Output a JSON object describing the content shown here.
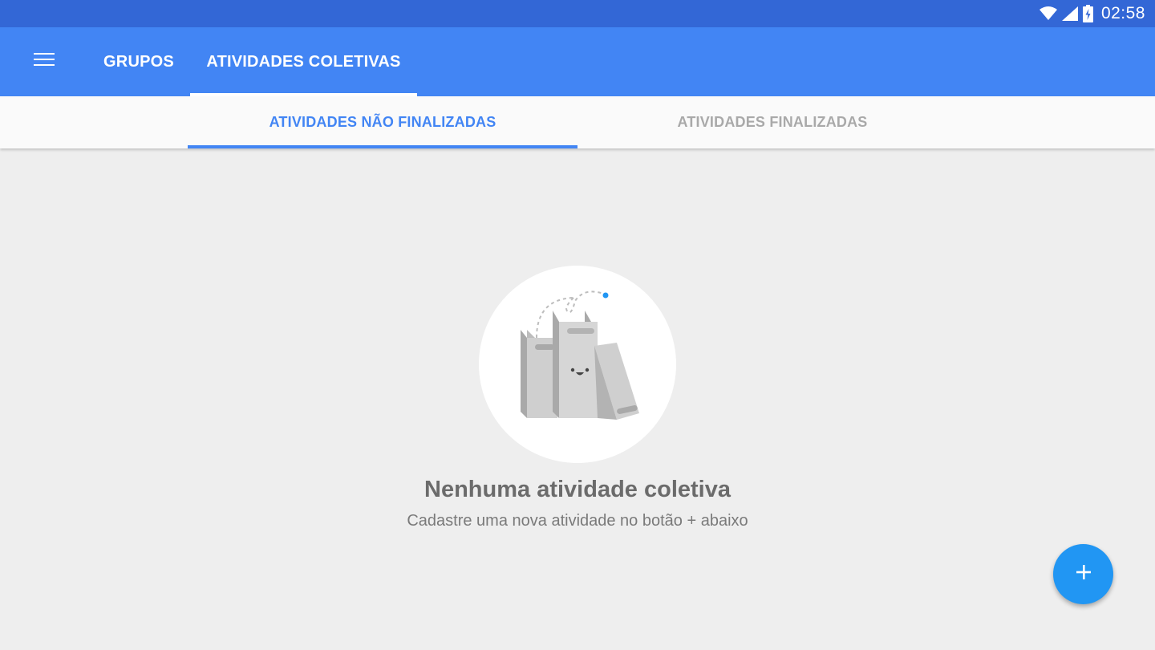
{
  "status_bar": {
    "time": "02:58",
    "icons": [
      "wifi-icon",
      "cell-signal-icon",
      "battery-charging-icon"
    ]
  },
  "app_bar": {
    "menu_icon": "hamburger-menu-icon",
    "tabs": [
      {
        "label": "GRUPOS",
        "selected": false
      },
      {
        "label": "ATIVIDADES COLETIVAS",
        "selected": true
      }
    ]
  },
  "sub_tabs": [
    {
      "label": "ATIVIDADES NÃO FINALIZADAS",
      "selected": true
    },
    {
      "label": "ATIVIDADES FINALIZADAS",
      "selected": false
    }
  ],
  "empty_state": {
    "illustration": "binders-illustration",
    "title": "Nenhuma atividade coletiva",
    "subtitle": "Cadastre uma nova atividade no botão + abaixo"
  },
  "fab": {
    "icon": "plus-icon"
  },
  "colors": {
    "status_bar": "#3367d6",
    "app_bar": "#4285f4",
    "accent": "#4285f4",
    "fab": "#2196f3",
    "background": "#eeeeee"
  }
}
